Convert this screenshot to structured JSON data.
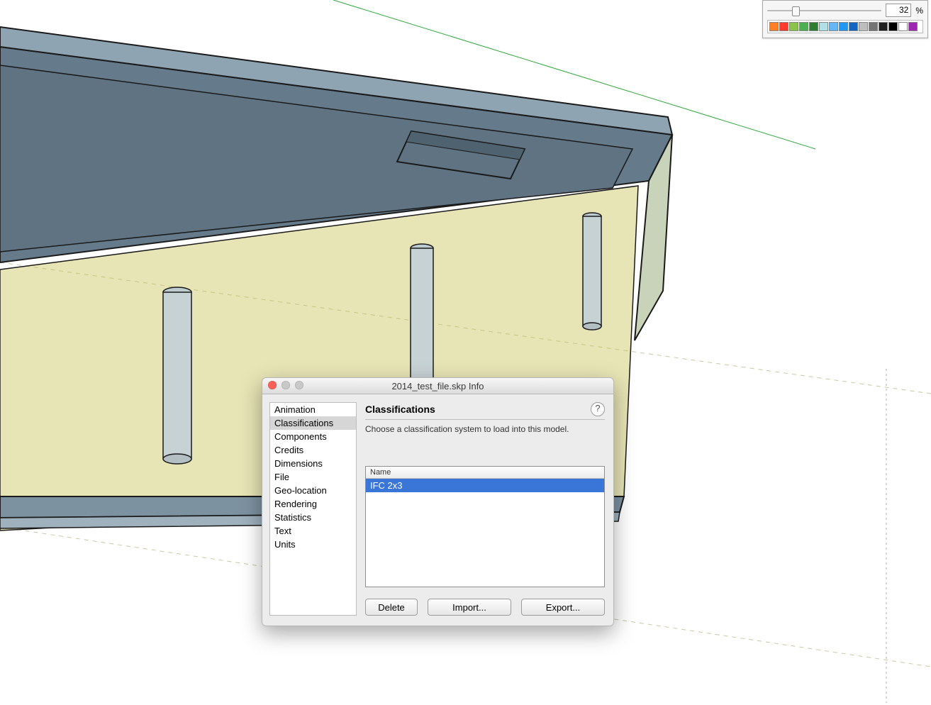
{
  "palette": {
    "value": "32",
    "unit": "%",
    "swatches": [
      "#ff7f27",
      "#ff3b30",
      "#8bc34a",
      "#4caf50",
      "#2e7d32",
      "#b0e0e6",
      "#64b5f6",
      "#2196f3",
      "#1565c0",
      "#bdbdbd",
      "#757575",
      "#212121",
      "#000000",
      "#ffffff",
      "#9c27b0"
    ]
  },
  "dialog": {
    "title": "2014_test_file.skp Info",
    "sidebar": [
      "Animation",
      "Classifications",
      "Components",
      "Credits",
      "Dimensions",
      "File",
      "Geo-location",
      "Rendering",
      "Statistics",
      "Text",
      "Units"
    ],
    "sidebar_selected": 1,
    "panel_title": "Classifications",
    "hint": "Choose a classification system to load into this model.",
    "list_header": "Name",
    "list_items": [
      "IFC 2x3"
    ],
    "buttons": {
      "delete": "Delete",
      "import": "Import...",
      "export": "Export..."
    },
    "traffic": {
      "close": "#ff5f57",
      "min": "#c8c8c8",
      "zoom": "#c8c8c8"
    }
  }
}
